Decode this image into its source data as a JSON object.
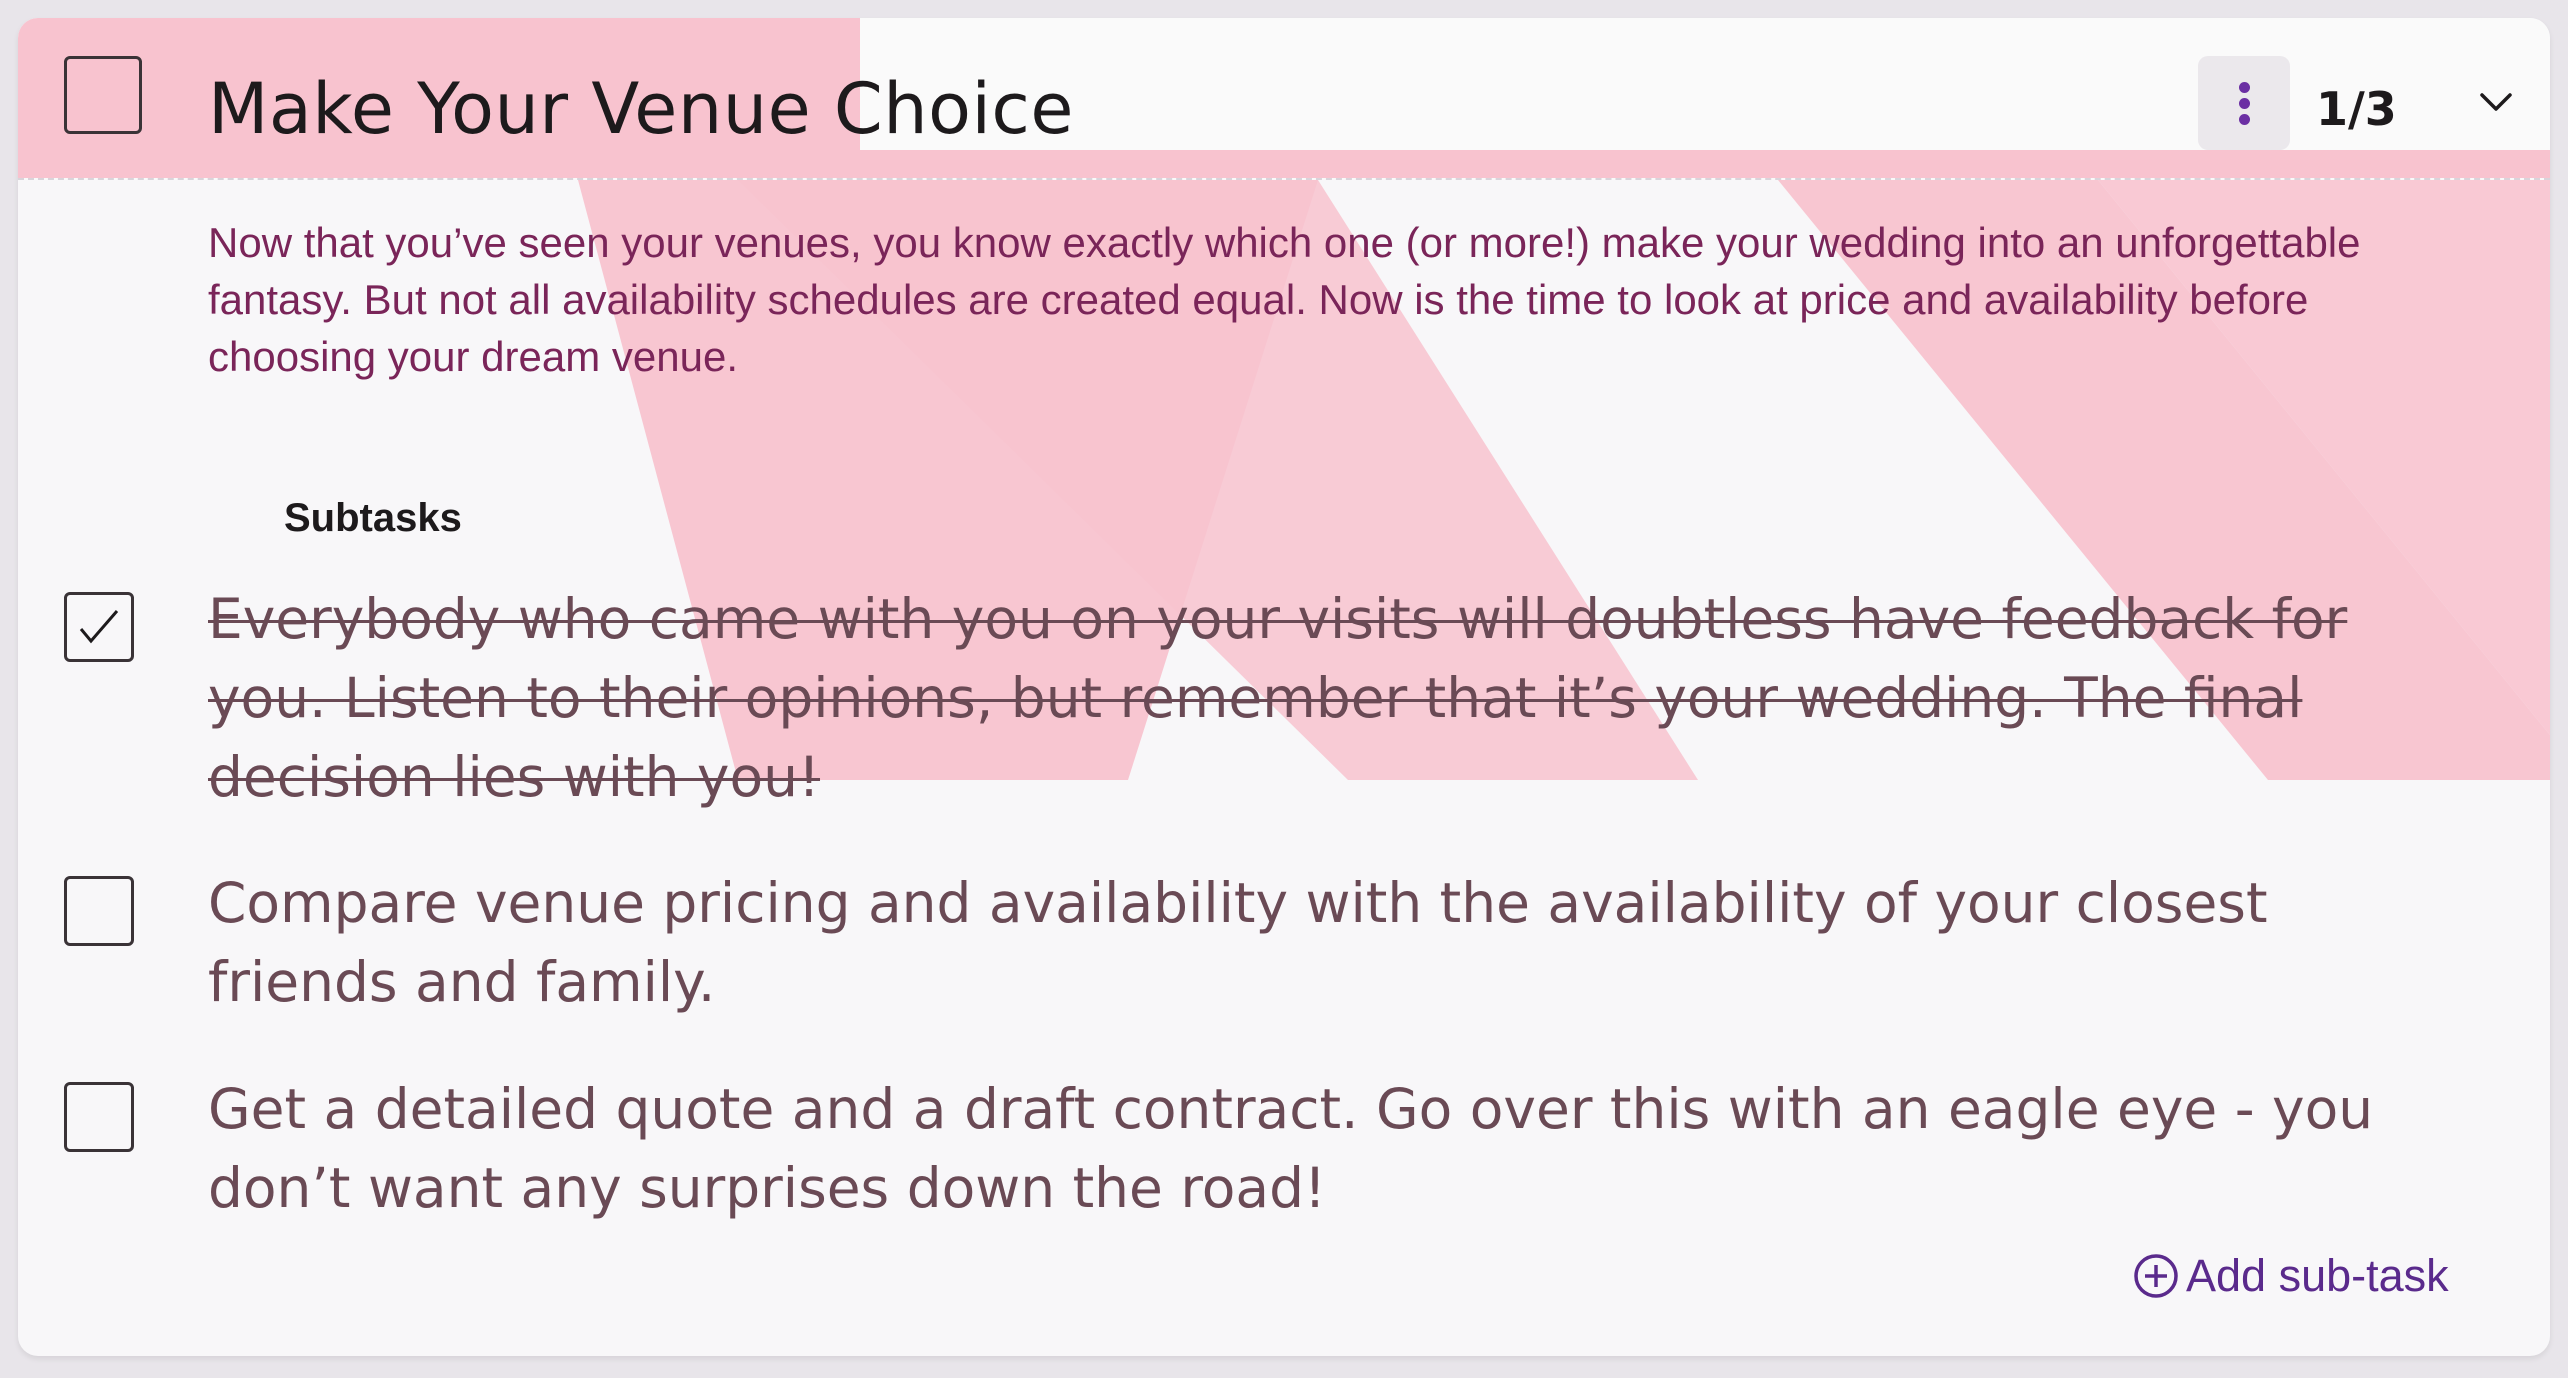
{
  "task": {
    "title": "Make Your Venue Choice",
    "completed": false,
    "progress_counter": "1/3",
    "progress_fraction": 0.333,
    "description": "Now that you’ve seen your venues, you know exactly which one (or more!) make your wedding into an unforgettable fantasy. But not all availability schedules are created equal. Now is the time to look at price and availability before choosing your dream venue."
  },
  "subtasks": {
    "heading": "Subtasks",
    "items": [
      {
        "text": "Everybody who came with you on your visits will doubtless have feedback for you. Listen to their opinions, but remember that it’s your wedding. The final decision lies with you!",
        "checked": true
      },
      {
        "text": "Compare venue pricing and availability with the availability of your closest friends and family.",
        "checked": false
      },
      {
        "text": "Get a detailed quote and a draft contract. Go over this with an eagle eye - you don’t want any surprises down the road!",
        "checked": false
      }
    ],
    "add_label": "Add sub-task"
  },
  "colors": {
    "progress_pink": "#f8c3cf",
    "description_text": "#7a2559",
    "accent_purple": "#6b2fa3",
    "subtask_text": "#6a4a55"
  },
  "icons": {
    "menu": "kebab-vertical-icon",
    "expand": "chevron-down-icon",
    "checked": "checkmark-icon",
    "add": "plus-circle-icon"
  }
}
